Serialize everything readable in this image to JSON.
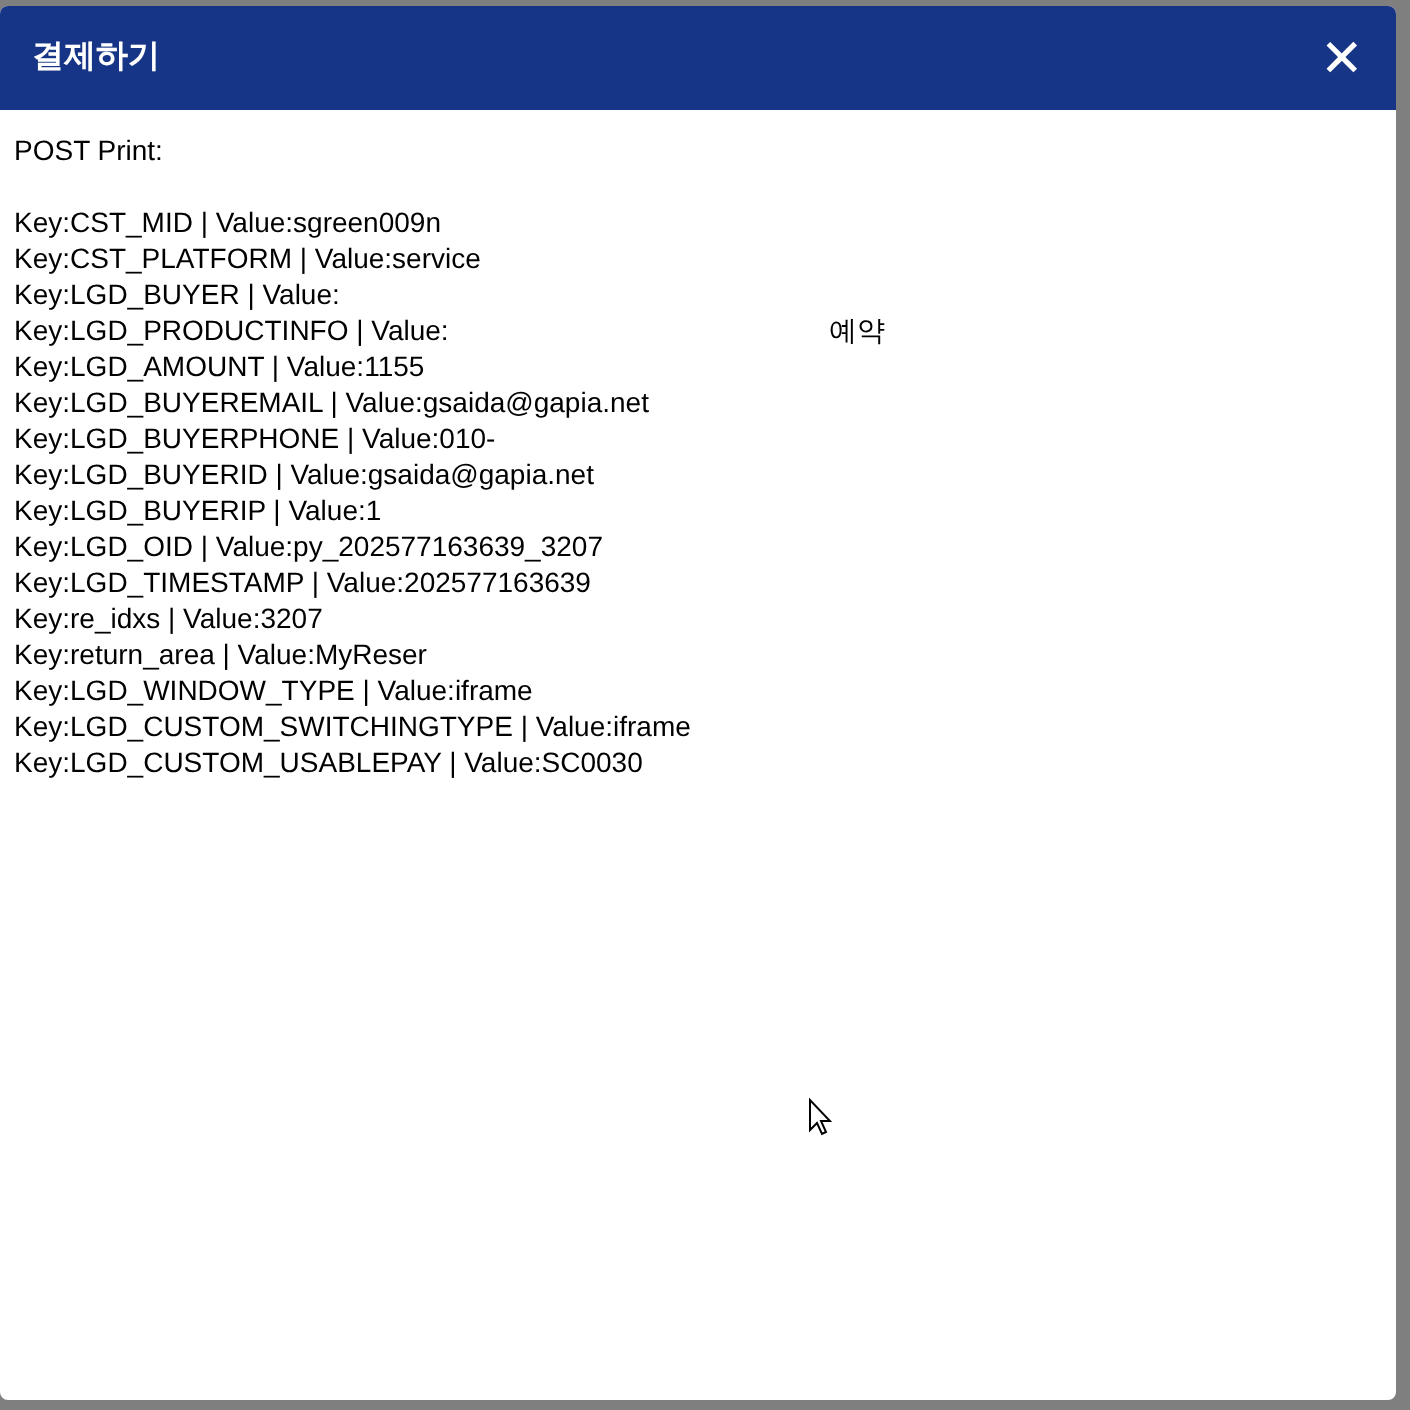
{
  "dialog": {
    "title": "결제하기",
    "close": "✕"
  },
  "heading": "POST Print:",
  "lines": [
    {
      "text": "Key:CST_MID | Value:sgreen009n"
    },
    {
      "text": "Key:CST_PLATFORM | Value:service"
    },
    {
      "text": "Key:LGD_BUYER | Value:"
    },
    {
      "text": "Key:LGD_PRODUCTINFO | Value:",
      "tail": "예약"
    },
    {
      "text": "Key:LGD_AMOUNT | Value:1155"
    },
    {
      "text": "Key:LGD_BUYEREMAIL | Value:gsaida@gapia.net"
    },
    {
      "text": "Key:LGD_BUYERPHONE | Value:010-"
    },
    {
      "text": "Key:LGD_BUYERID | Value:gsaida@gapia.net"
    },
    {
      "text": "Key:LGD_BUYERIP | Value:1"
    },
    {
      "text": "Key:LGD_OID | Value:py_202577163639_3207"
    },
    {
      "text": "Key:LGD_TIMESTAMP | Value:202577163639"
    },
    {
      "text": "Key:re_idxs | Value:3207"
    },
    {
      "text": "Key:return_area | Value:MyReser"
    },
    {
      "text": "Key:LGD_WINDOW_TYPE | Value:iframe"
    },
    {
      "text": "Key:LGD_CUSTOM_SWITCHINGTYPE | Value:iframe"
    },
    {
      "text": "Key:LGD_CUSTOM_USABLEPAY | Value:SC0030"
    }
  ]
}
